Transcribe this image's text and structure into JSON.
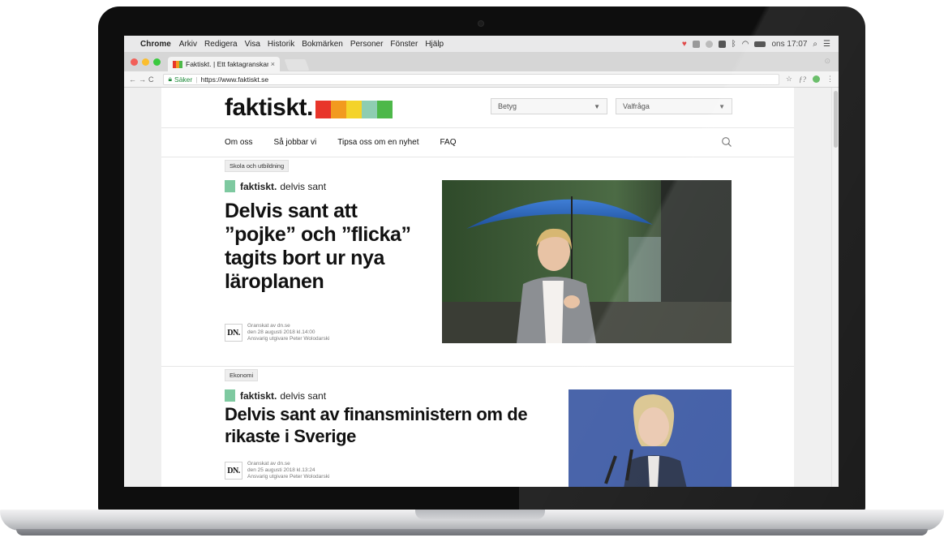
{
  "menubar": {
    "app_name": "Chrome",
    "items": [
      "Arkiv",
      "Redigera",
      "Visa",
      "Historik",
      "Bokmärken",
      "Personer",
      "Fönster",
      "Hjälp"
    ],
    "clock": "ons 17:07"
  },
  "browser": {
    "tab_title": "Faktiskt. | Ett faktagranskande",
    "secure_label": "Säker",
    "url": "https://www.faktiskt.se"
  },
  "site": {
    "logo_text": "faktiskt.",
    "logo_colors": [
      "#e8352a",
      "#f29a1f",
      "#f4d32a",
      "#8ecdb1",
      "#4db849"
    ],
    "select_rating": "Betyg",
    "select_question": "Valfråga",
    "nav": [
      "Om oss",
      "Så jobbar vi",
      "Tipsa oss om en nyhet",
      "FAQ"
    ]
  },
  "articles": [
    {
      "category": "Skola och utbildning",
      "verdict_brand": "faktiskt.",
      "verdict": "delvis sant",
      "headline": "Delvis sant att ”pojke” och ”flicka” tagits bort ur nya läroplanen",
      "source_logo": "DN.",
      "meta_line1": "Granskat av dn.se",
      "meta_line2": "den 28 augusti 2018 kl.14:00",
      "meta_line3": "Ansvarig utgivare Peter Wolodarski"
    },
    {
      "category": "Ekonomi",
      "verdict_brand": "faktiskt.",
      "verdict": "delvis sant",
      "headline": "Delvis sant av finansministern om de rikaste i Sverige",
      "source_logo": "DN.",
      "meta_line1": "Granskat av dn.se",
      "meta_line2": "den 25 augusti 2018 kl.13:24",
      "meta_line3": "Ansvarig utgivare Peter Wolodarski"
    }
  ],
  "colors": {
    "verdict_partly_true": "#7ec9a0",
    "secure_green": "#1e8a3a"
  }
}
